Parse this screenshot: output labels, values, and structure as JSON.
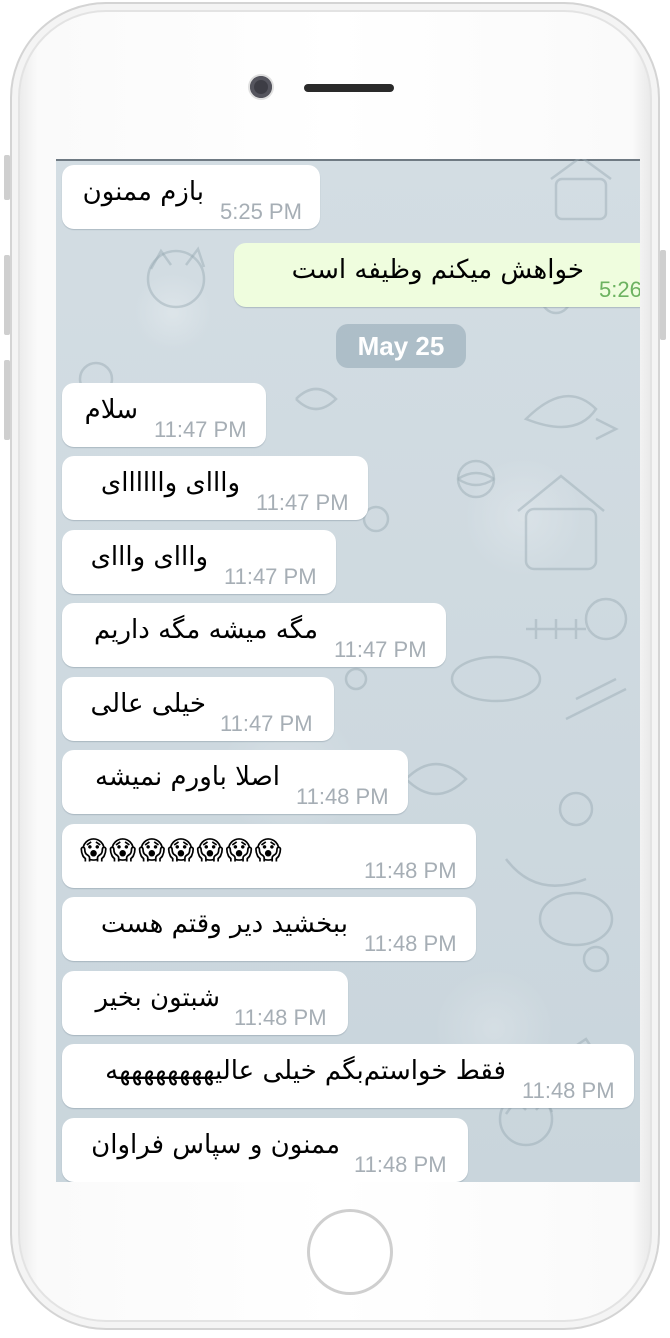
{
  "chat": {
    "date_separator": "May 25",
    "messages": [
      {
        "direction": "in",
        "text": "بازم ممنون",
        "time": "5:25 PM"
      },
      {
        "direction": "out",
        "text": "خواهش میکنم   وظیفه است",
        "time": "5:26"
      },
      {
        "direction": "in",
        "text": "سلام",
        "time": "11:47 PM"
      },
      {
        "direction": "in",
        "text": "وااای واااااای",
        "time": "11:47 PM"
      },
      {
        "direction": "in",
        "text": "وااای وااای",
        "time": "11:47 PM"
      },
      {
        "direction": "in",
        "text": "مگه میشه مگه داریم",
        "time": "11:47 PM"
      },
      {
        "direction": "in",
        "text": "خیلی عالی",
        "time": "11:47 PM"
      },
      {
        "direction": "in",
        "text": "اصلا باورم نمیشه",
        "time": "11:48 PM"
      },
      {
        "direction": "in",
        "text": "😱😱😱😱😱😱😱",
        "time": "11:48 PM"
      },
      {
        "direction": "in",
        "text": "ببخشید دیر وقتم هست",
        "time": "11:48 PM"
      },
      {
        "direction": "in",
        "text": "شبتون بخیر",
        "time": "11:48 PM"
      },
      {
        "direction": "in",
        "text": "فقط خواستم‌بگم خیلی عالیههههههههه",
        "time": "11:48 PM"
      },
      {
        "direction": "in",
        "text": "ممنون و سپاس فراوان",
        "time": "11:48 PM"
      }
    ]
  },
  "colors": {
    "incoming_bubble": "#ffffff",
    "outgoing_bubble": "#effdde",
    "outgoing_time": "#6cb260",
    "incoming_time": "#a6aeb5",
    "chat_background": "#cfd9df"
  },
  "icons": [
    "front-camera-icon",
    "speaker-grille-icon",
    "home-button-icon"
  ]
}
